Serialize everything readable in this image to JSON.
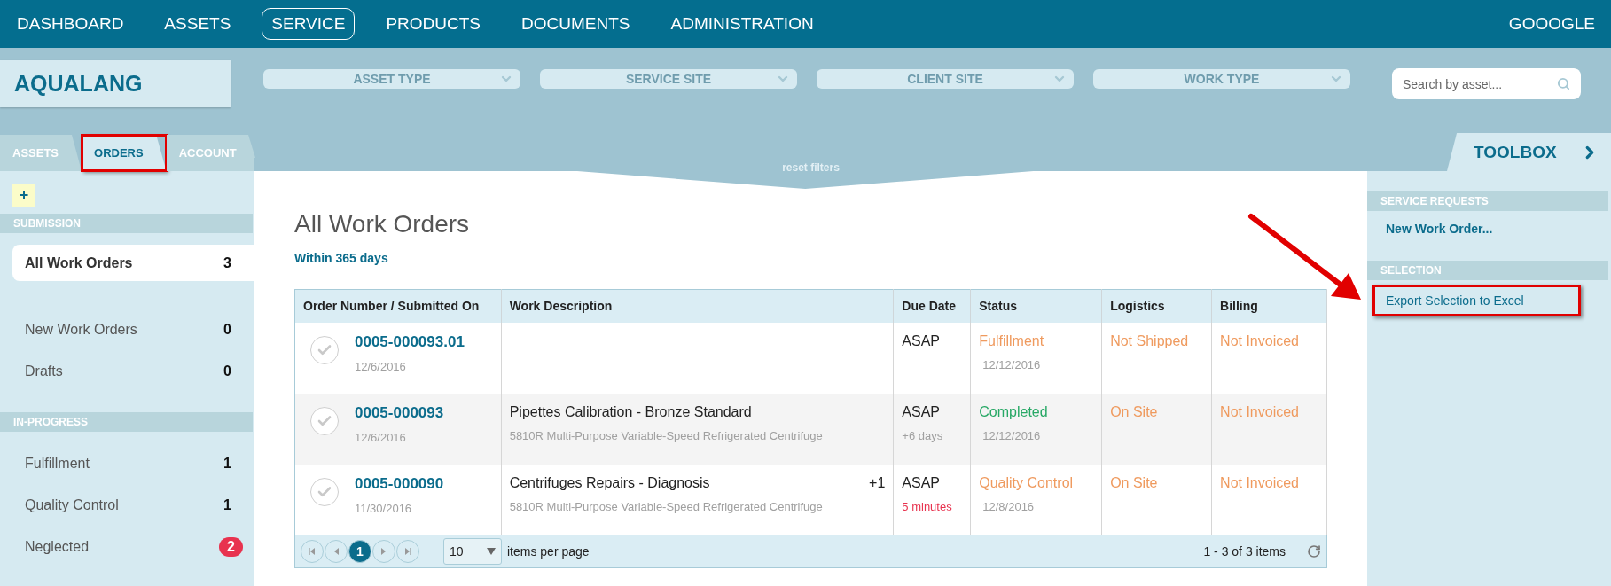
{
  "nav": {
    "items": [
      {
        "label": "DASHBOARD",
        "selected": false
      },
      {
        "label": "ASSETS",
        "selected": false
      },
      {
        "label": "SERVICE",
        "selected": true
      },
      {
        "label": "PRODUCTS",
        "selected": false
      },
      {
        "label": "DOCUMENTS",
        "selected": false
      },
      {
        "label": "ADMINISTRATION",
        "selected": false
      }
    ],
    "user": "GOOOGLE"
  },
  "brand": "AQUALANG",
  "filters": [
    {
      "label": "ASSET TYPE"
    },
    {
      "label": "SERVICE SITE"
    },
    {
      "label": "CLIENT SITE"
    },
    {
      "label": "WORK TYPE"
    }
  ],
  "search": {
    "placeholder": "Search by asset..."
  },
  "side_tabs": [
    {
      "label": "ASSETS",
      "selected": false,
      "highlighted": false
    },
    {
      "label": "ORDERS",
      "selected": true,
      "highlighted": true
    },
    {
      "label": "ACCOUNT",
      "selected": false,
      "highlighted": false
    }
  ],
  "reset_filters": "reset filters",
  "sidebar": {
    "add_label": "+",
    "sections": [
      {
        "heading": "SUBMISSION",
        "items": [
          {
            "label": "All Work Orders",
            "count": "3",
            "selected": true,
            "alert": false
          },
          {
            "label": "New Work Orders",
            "count": "0",
            "selected": false,
            "alert": false
          },
          {
            "label": "Drafts",
            "count": "0",
            "selected": false,
            "alert": false
          }
        ]
      },
      {
        "heading": "IN-PROGRESS",
        "items": [
          {
            "label": "Fulfillment",
            "count": "1",
            "selected": false,
            "alert": false
          },
          {
            "label": "Quality Control",
            "count": "1",
            "selected": false,
            "alert": false
          },
          {
            "label": "Neglected",
            "count": "2",
            "selected": false,
            "alert": true
          }
        ]
      }
    ]
  },
  "main": {
    "title": "All Work Orders",
    "subtitle": "Within 365 days",
    "table": {
      "columns": [
        "Order Number / Submitted On",
        "Work Description",
        "Due Date",
        "Status",
        "Logistics",
        "Billing"
      ],
      "rows": [
        {
          "selected": false,
          "order": "0005-000093.01",
          "submitted": "12/6/2016",
          "due": "ASAP",
          "status": {
            "text": "Fulfillment",
            "color": "#ef9a5e"
          },
          "status_date": "12/12/2016",
          "logistics": "Not Shipped",
          "billing": "Not Invoiced"
        },
        {
          "selected": false,
          "order": "0005-000093",
          "submitted": "12/6/2016",
          "description": "Pipettes Calibration - Bronze Standard",
          "asset": "5810R Multi-Purpose Variable-Speed Refrigerated Centrifuge",
          "due": "ASAP",
          "due_note": {
            "text": "+6 days",
            "color": "#a0a0a0"
          },
          "status": {
            "text": "Completed",
            "color": "#27a865"
          },
          "status_date": "12/12/2016",
          "logistics": "On Site",
          "billing": "Not Invoiced"
        },
        {
          "selected": false,
          "order": "0005-000090",
          "submitted": "11/30/2016",
          "description": "Centrifuges Repairs - Diagnosis",
          "extra": "+1",
          "asset": "5810R Multi-Purpose Variable-Speed Refrigerated Centrifuge",
          "due": "ASAP",
          "due_note": {
            "text": "5 minutes",
            "color": "#e8334f"
          },
          "status": {
            "text": "Quality Control",
            "color": "#ef9a5e"
          },
          "status_date": "12/8/2016",
          "logistics": "On Site",
          "billing": "Not Invoiced"
        }
      ]
    },
    "pager": {
      "pages": [
        {
          "label": "1",
          "selected": true
        }
      ],
      "page_size": "10",
      "page_size_label": "items per page",
      "summary": "1 - 3 of 3 items"
    }
  },
  "toolbox": {
    "title": "TOOLBOX",
    "sections": [
      {
        "heading": "SERVICE REQUESTS",
        "items": [
          {
            "label": "New Work Order...",
            "kind": "action",
            "highlighted": false
          }
        ]
      },
      {
        "heading": "SELECTION",
        "items": [
          {
            "label": "Export Selection to Excel",
            "kind": "link",
            "highlighted": true
          }
        ]
      }
    ]
  }
}
